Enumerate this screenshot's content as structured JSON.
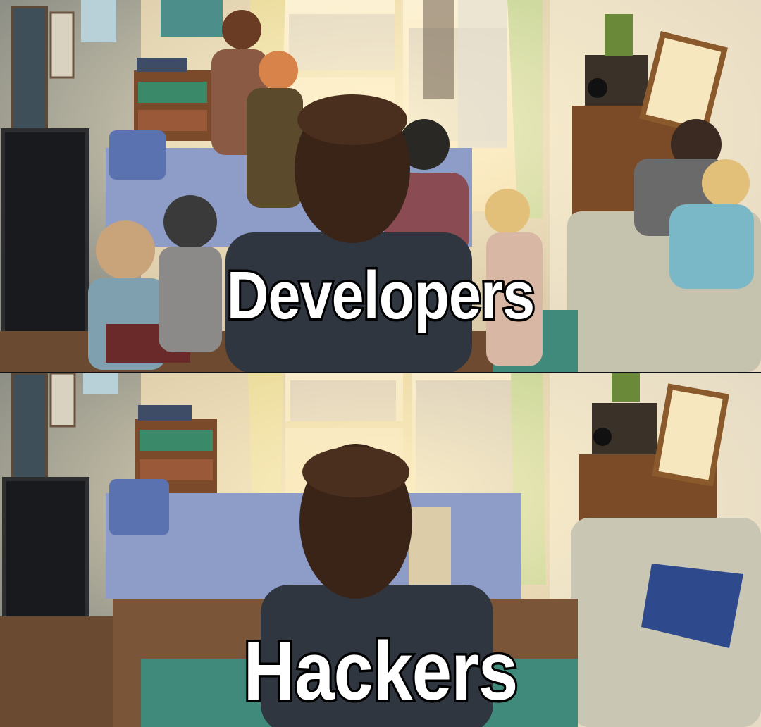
{
  "meme": {
    "top_caption": "Developers",
    "bottom_caption": "Hackers"
  },
  "colors": {
    "wall": "#e9dcc0",
    "window_light": "#f6ecd0",
    "curtain": "#c9d98f",
    "bed": "#8f9cc6",
    "floor": "#7a5636",
    "rug": "#3f8a7a",
    "sofa": "#c9c6b3",
    "hair": "#3a2418",
    "caption_fill": "#ffffff",
    "caption_stroke": "#000000"
  }
}
